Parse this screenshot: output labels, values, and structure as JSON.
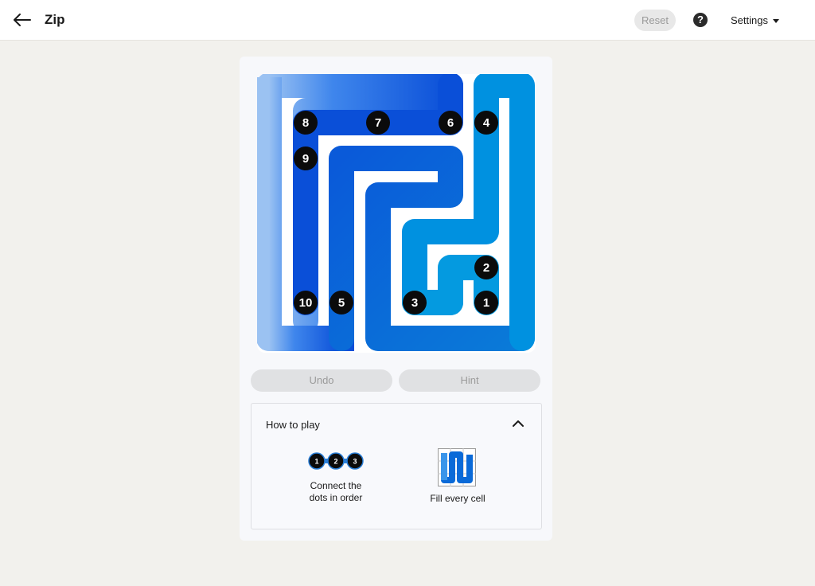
{
  "header": {
    "title": "Zip",
    "reset_label": "Reset",
    "help_icon": "?",
    "settings_label": "Settings"
  },
  "colors": {
    "path_dark": "#0a4fd8",
    "path_mid": "#0075e0",
    "path_light": "#0096e0",
    "dot": "#0b0b0b",
    "board_bg": "#ffffff"
  },
  "board": {
    "dots": [
      {
        "label": "8"
      },
      {
        "label": "7"
      },
      {
        "label": "6"
      },
      {
        "label": "4"
      },
      {
        "label": "9"
      },
      {
        "label": "2"
      },
      {
        "label": "10"
      },
      {
        "label": "5"
      },
      {
        "label": "3"
      },
      {
        "label": "1"
      }
    ]
  },
  "actions": {
    "undo_label": "Undo",
    "hint_label": "Hint"
  },
  "how_to_play": {
    "title": "How to play",
    "rule1_dots": [
      "1",
      "2",
      "3"
    ],
    "rule1_line1": "Connect the",
    "rule1_line2": "dots in order",
    "rule2_text": "Fill every cell"
  }
}
